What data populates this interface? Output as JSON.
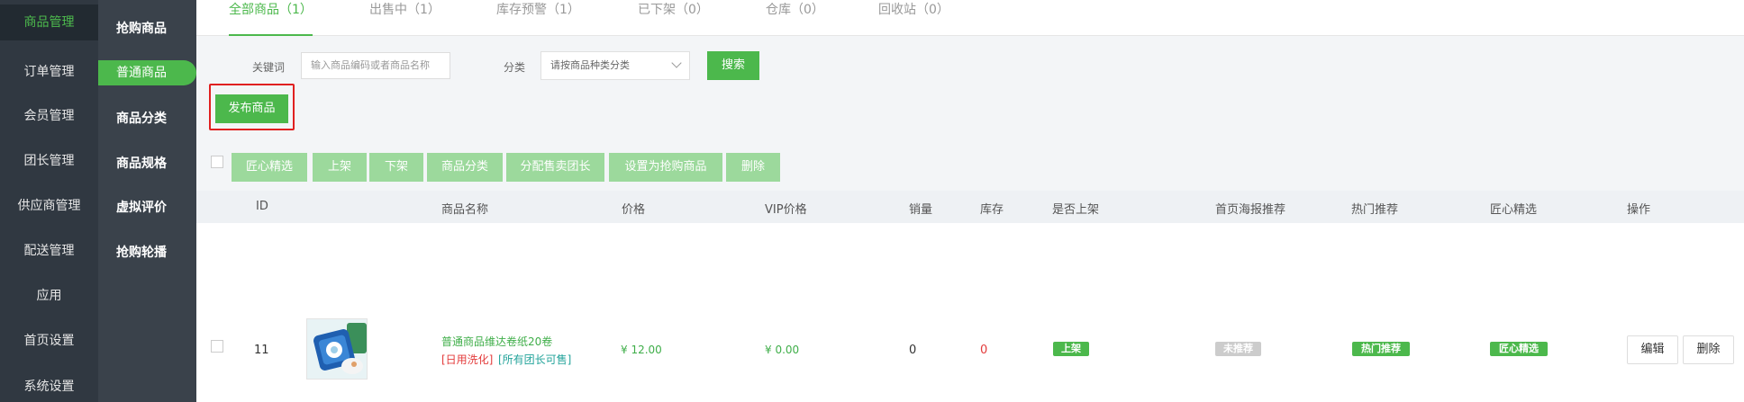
{
  "primary_nav": [
    {
      "label": "商品管理",
      "active": true
    },
    {
      "label": "订单管理"
    },
    {
      "label": "会员管理"
    },
    {
      "label": "团长管理"
    },
    {
      "label": "供应商管理"
    },
    {
      "label": "配送管理"
    },
    {
      "label": "应用"
    },
    {
      "label": "首页设置"
    },
    {
      "label": "系统设置"
    }
  ],
  "secondary_nav": [
    {
      "label": "抢购商品"
    },
    {
      "label": "普通商品",
      "active": true
    },
    {
      "label": "商品分类"
    },
    {
      "label": "商品规格"
    },
    {
      "label": "虚拟评价"
    },
    {
      "label": "抢购轮播"
    }
  ],
  "tabs": [
    {
      "label": "全部商品（1）",
      "active": true
    },
    {
      "label": "出售中（1）"
    },
    {
      "label": "库存预警（1）"
    },
    {
      "label": "已下架（0）"
    },
    {
      "label": "仓库（0）"
    },
    {
      "label": "回收站（0）"
    }
  ],
  "filter": {
    "keyword_label": "关键词",
    "keyword_placeholder": "输入商品编码或者商品名称",
    "category_label": "分类",
    "category_value": "请按商品种类分类",
    "search_label": "搜索"
  },
  "publish_label": "发布商品",
  "bulk_actions": [
    "匠心精选",
    "上架",
    "下架",
    "商品分类",
    "分配售卖团长",
    "设置为抢购商品",
    "删除"
  ],
  "table": {
    "headers": [
      "ID",
      "商品名称",
      "价格",
      "VIP价格",
      "销量",
      "库存",
      "是否上架",
      "首页海报推荐",
      "热门推荐",
      "匠心精选",
      "操作"
    ],
    "rows": [
      {
        "id": "11",
        "name": "普通商品维达卷纸20卷",
        "tag_category": "[日用洗化]",
        "tag_sale": "[所有团长可售]",
        "price": "¥ 12.00",
        "vip_price": "¥ 0.00",
        "sales": "0",
        "stock": "0",
        "on_shelf": "上架",
        "poster": "未推荐",
        "hot": "热门推荐",
        "craft": "匠心精选",
        "edit_label": "编辑",
        "delete_label": "删除"
      }
    ]
  },
  "colors": {
    "accent": "#4cb84c",
    "sidebar_dark": "#303841",
    "sidebar_mid": "#3a424b",
    "danger": "#e02020",
    "badge_gray": "#cccccc"
  }
}
